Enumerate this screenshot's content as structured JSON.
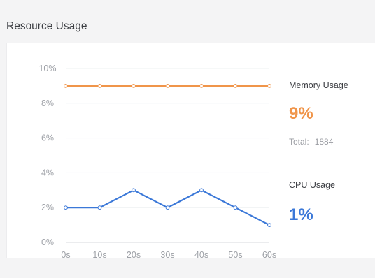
{
  "panel": {
    "title": "Resource Usage"
  },
  "memory": {
    "label": "Memory Usage",
    "value": "9%",
    "total_label": "Total:",
    "total_value": "1884",
    "color": "#f0954a"
  },
  "cpu": {
    "label": "CPU Usage",
    "value": "1%",
    "color": "#3b78d8"
  },
  "chart_data": {
    "type": "line",
    "x": [
      "0s",
      "10s",
      "20s",
      "30s",
      "40s",
      "50s",
      "60s"
    ],
    "series": [
      {
        "values": [
          9,
          9,
          9,
          9,
          9,
          9,
          9
        ],
        "color": "#f0954a"
      },
      {
        "values": [
          2,
          2,
          3,
          2,
          3,
          2,
          1
        ],
        "color": "#3b78d8"
      }
    ],
    "yticks": [
      "0%",
      "2%",
      "4%",
      "6%",
      "8%",
      "10%"
    ],
    "ylim": [
      0,
      10
    ],
    "grid": true,
    "legend": "none"
  }
}
